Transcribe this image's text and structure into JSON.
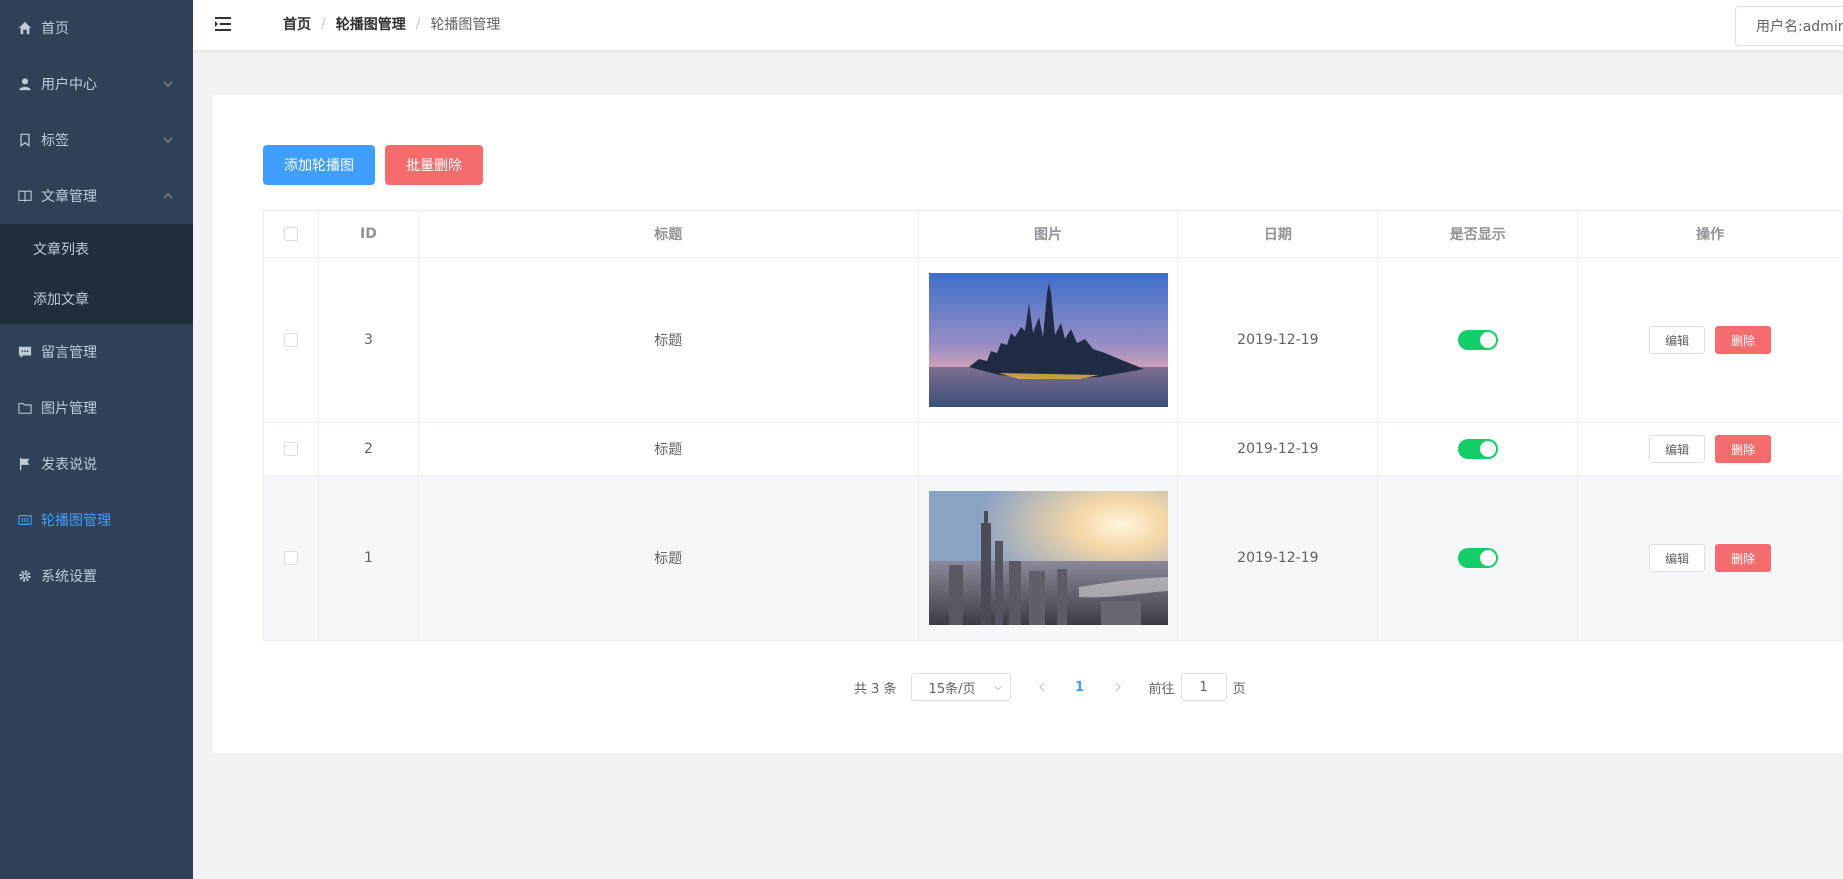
{
  "sidebar": {
    "items": [
      {
        "label": "首页",
        "icon": "home-icon"
      },
      {
        "label": "用户中心",
        "icon": "user-icon",
        "expandable": true
      },
      {
        "label": "标签",
        "icon": "bookmark-icon",
        "expandable": true
      },
      {
        "label": "文章管理",
        "icon": "book-icon",
        "expandable": true,
        "expanded": true,
        "children": [
          {
            "label": "文章列表"
          },
          {
            "label": "添加文章"
          }
        ]
      },
      {
        "label": "留言管理",
        "icon": "message-icon"
      },
      {
        "label": "图片管理",
        "icon": "folder-icon"
      },
      {
        "label": "发表说说",
        "icon": "flag-icon"
      },
      {
        "label": "轮播图管理",
        "icon": "carousel-icon",
        "active": true
      },
      {
        "label": "系统设置",
        "icon": "gear-icon"
      }
    ]
  },
  "header": {
    "breadcrumb": [
      "首页",
      "轮播图管理",
      "轮播图管理"
    ],
    "user_label": "用户名:admin"
  },
  "toolbar": {
    "add_label": "添加轮播图",
    "batch_delete_label": "批量删除"
  },
  "table": {
    "columns": [
      "ID",
      "标题",
      "图片",
      "日期",
      "是否显示",
      "操作"
    ],
    "rows": [
      {
        "id": "3",
        "title": "标题",
        "image": "city-dusk-image",
        "date": "2019-12-19",
        "visible": true
      },
      {
        "id": "2",
        "title": "标题",
        "image": "",
        "date": "2019-12-19",
        "visible": true
      },
      {
        "id": "1",
        "title": "标题",
        "image": "city-sunrise-image",
        "date": "2019-12-19",
        "visible": true
      }
    ],
    "edit_label": "编辑",
    "delete_label": "删除"
  },
  "pagination": {
    "total_text": "共 3 条",
    "page_size": "15条/页",
    "current_page": "1",
    "goto_label": "前往",
    "goto_value": "1",
    "page_suffix": "页"
  },
  "colors": {
    "sidebar_bg": "#304156",
    "accent": "#409eff",
    "danger": "#f56c6c",
    "switch_on": "#13ce66"
  }
}
